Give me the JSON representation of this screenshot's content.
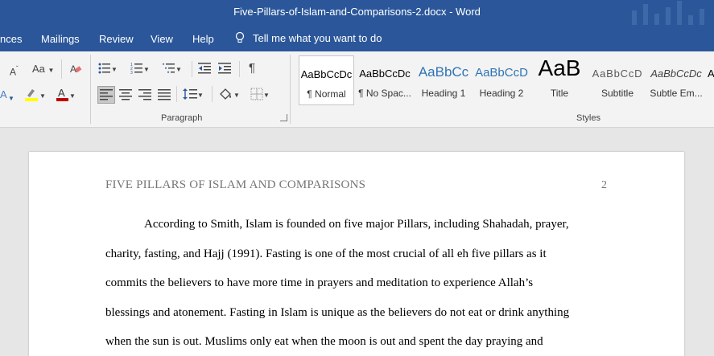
{
  "window": {
    "title": "Five-Pillars-of-Islam-and-Comparisons-2.docx  -  Word"
  },
  "ribbon_tabs": [
    {
      "label": "nces"
    },
    {
      "label": "Mailings"
    },
    {
      "label": "Review"
    },
    {
      "label": "View"
    },
    {
      "label": "Help"
    }
  ],
  "tell_me": {
    "text": "Tell me what you want to do",
    "icon": "lightbulb-icon"
  },
  "font_group": {
    "change_case": "Aa",
    "font_size_small": "A"
  },
  "groups": {
    "paragraph": "Paragraph",
    "styles": "Styles"
  },
  "styles": [
    {
      "preview": "AaBbCcDc",
      "name": "¶ Normal",
      "selected": true
    },
    {
      "preview": "AaBbCcDc",
      "name": "¶ No Spac..."
    },
    {
      "preview": "AaBbCc",
      "name": "Heading 1"
    },
    {
      "preview": "AaBbCcD",
      "name": "Heading 2"
    },
    {
      "preview": "AaB",
      "name": "Title"
    },
    {
      "preview": "AaBbCcD",
      "name": "Subtitle"
    },
    {
      "preview": "AaBbCcDc",
      "name": "Subtle Em..."
    },
    {
      "preview": "A",
      "name": ""
    }
  ],
  "colors": {
    "accent": "#2b579a",
    "highlight": "#ffff00",
    "font_color": "#c00000"
  },
  "document": {
    "header": "FIVE PILLARS OF ISLAM AND COMPARISONS",
    "page_number": "2",
    "lines": [
      "According to Smith, Islam is founded on five major Pillars, including Shahadah, prayer,",
      "charity, fasting, and Hajj (1991). Fasting is one of the most crucial of all eh five pillars as it",
      "commits the believers to have more time in prayers and meditation to experience Allah’s",
      "blessings and atonement. Fasting in Islam is unique as the believers do not eat or drink anything",
      "when the sun is out. Muslims only eat when the moon is out and spent the day praying and"
    ]
  }
}
